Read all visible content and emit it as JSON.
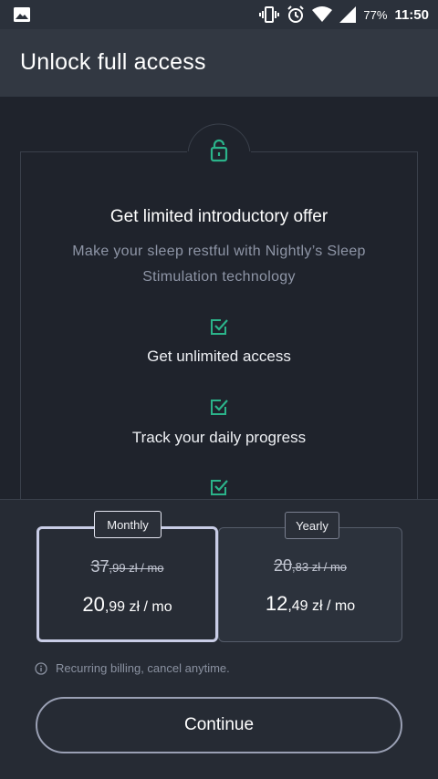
{
  "status_bar": {
    "battery": "77%",
    "time": "11:50"
  },
  "header": {
    "title": "Unlock full access"
  },
  "offer": {
    "headline": "Get limited introductory offer",
    "subtitle": "Make your sleep restful with Nightly’s Sleep Stimulation technology",
    "features": [
      {
        "label": "Get unlimited access",
        "icon": "check-square-icon"
      },
      {
        "label": "Track your daily progress",
        "icon": "check-square-icon"
      },
      {
        "label": "",
        "icon": "check-square-icon"
      }
    ],
    "icon": "lock-icon",
    "accent_color": "#2bb38a"
  },
  "plans": {
    "monthly": {
      "tag": "Monthly",
      "old_main": "37",
      "old_rest": ",99 zł / mo",
      "new_main": "20",
      "new_rest": ",99 zł / mo",
      "selected": true
    },
    "yearly": {
      "tag": "Yearly",
      "old_main": "20",
      "old_rest": ",83 zł / mo",
      "new_main": "12",
      "new_rest": ",49 zł / mo",
      "selected": false
    }
  },
  "billing_note": "Recurring billing, cancel anytime.",
  "cta": {
    "label": "Continue"
  }
}
